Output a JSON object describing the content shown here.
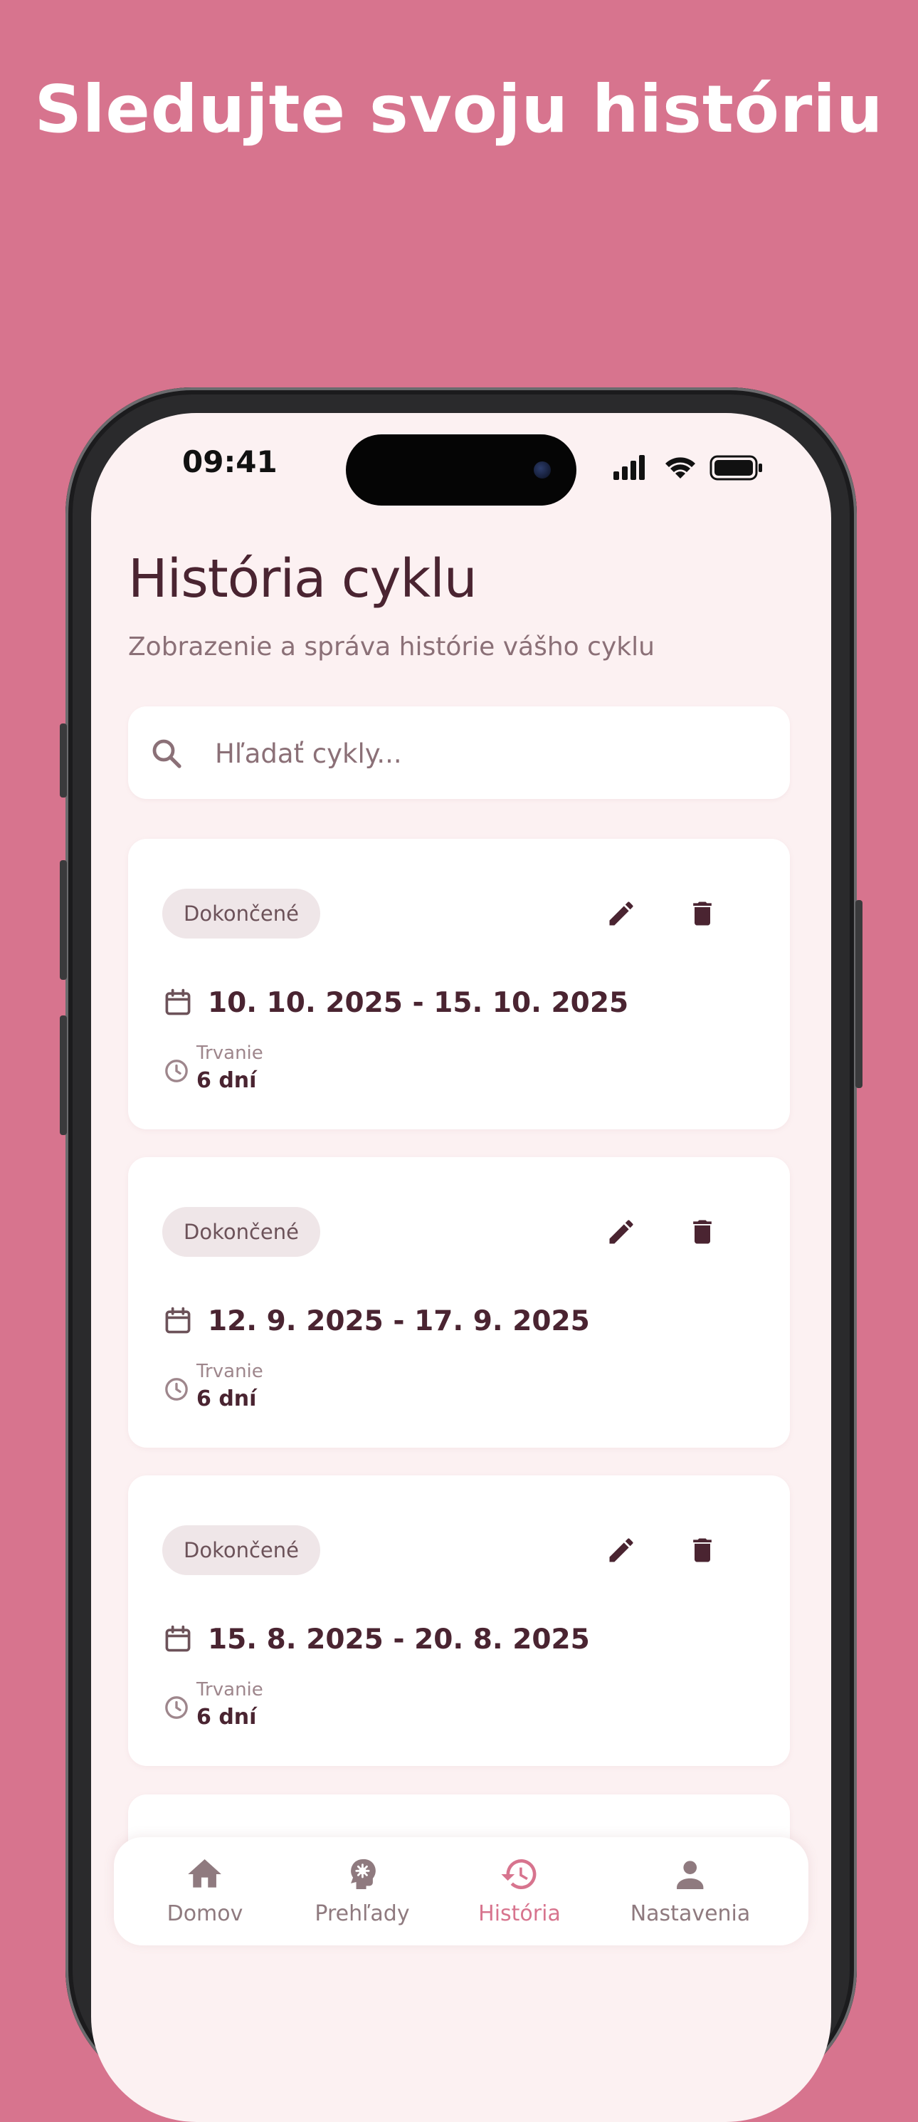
{
  "promo": {
    "headline": "Sledujte svoju históriu"
  },
  "status_bar": {
    "time": "09:41"
  },
  "page": {
    "title": "História cyklu",
    "subtitle": "Zobrazenie a správa histórie vášho cyklu"
  },
  "search": {
    "placeholder": "Hľadať cykly...",
    "value": ""
  },
  "cycles": [
    {
      "status": "Dokončené",
      "date_range": "10. 10. 2025 - 15. 10. 2025",
      "duration_label": "Trvanie",
      "duration_value": "6 dní"
    },
    {
      "status": "Dokončené",
      "date_range": "12. 9. 2025 - 17. 9. 2025",
      "duration_label": "Trvanie",
      "duration_value": "6 dní"
    },
    {
      "status": "Dokončené",
      "date_range": "15. 8. 2025 - 20. 8. 2025",
      "duration_label": "Trvanie",
      "duration_value": "6 dní"
    }
  ],
  "bottom_nav": {
    "items": [
      {
        "label": "Domov",
        "icon": "home-icon",
        "active": false
      },
      {
        "label": "Prehľady",
        "icon": "insights-icon",
        "active": false
      },
      {
        "label": "História",
        "icon": "history-icon",
        "active": true
      },
      {
        "label": "Nastavenia",
        "icon": "person-icon",
        "active": false
      }
    ]
  },
  "colors": {
    "background": "#D7748E",
    "screen_background": "#FCF1F2",
    "primary_text": "#4A2431",
    "secondary_text": "#8B7077",
    "accent": "#D7748E",
    "badge_background": "#EFE6E8"
  }
}
